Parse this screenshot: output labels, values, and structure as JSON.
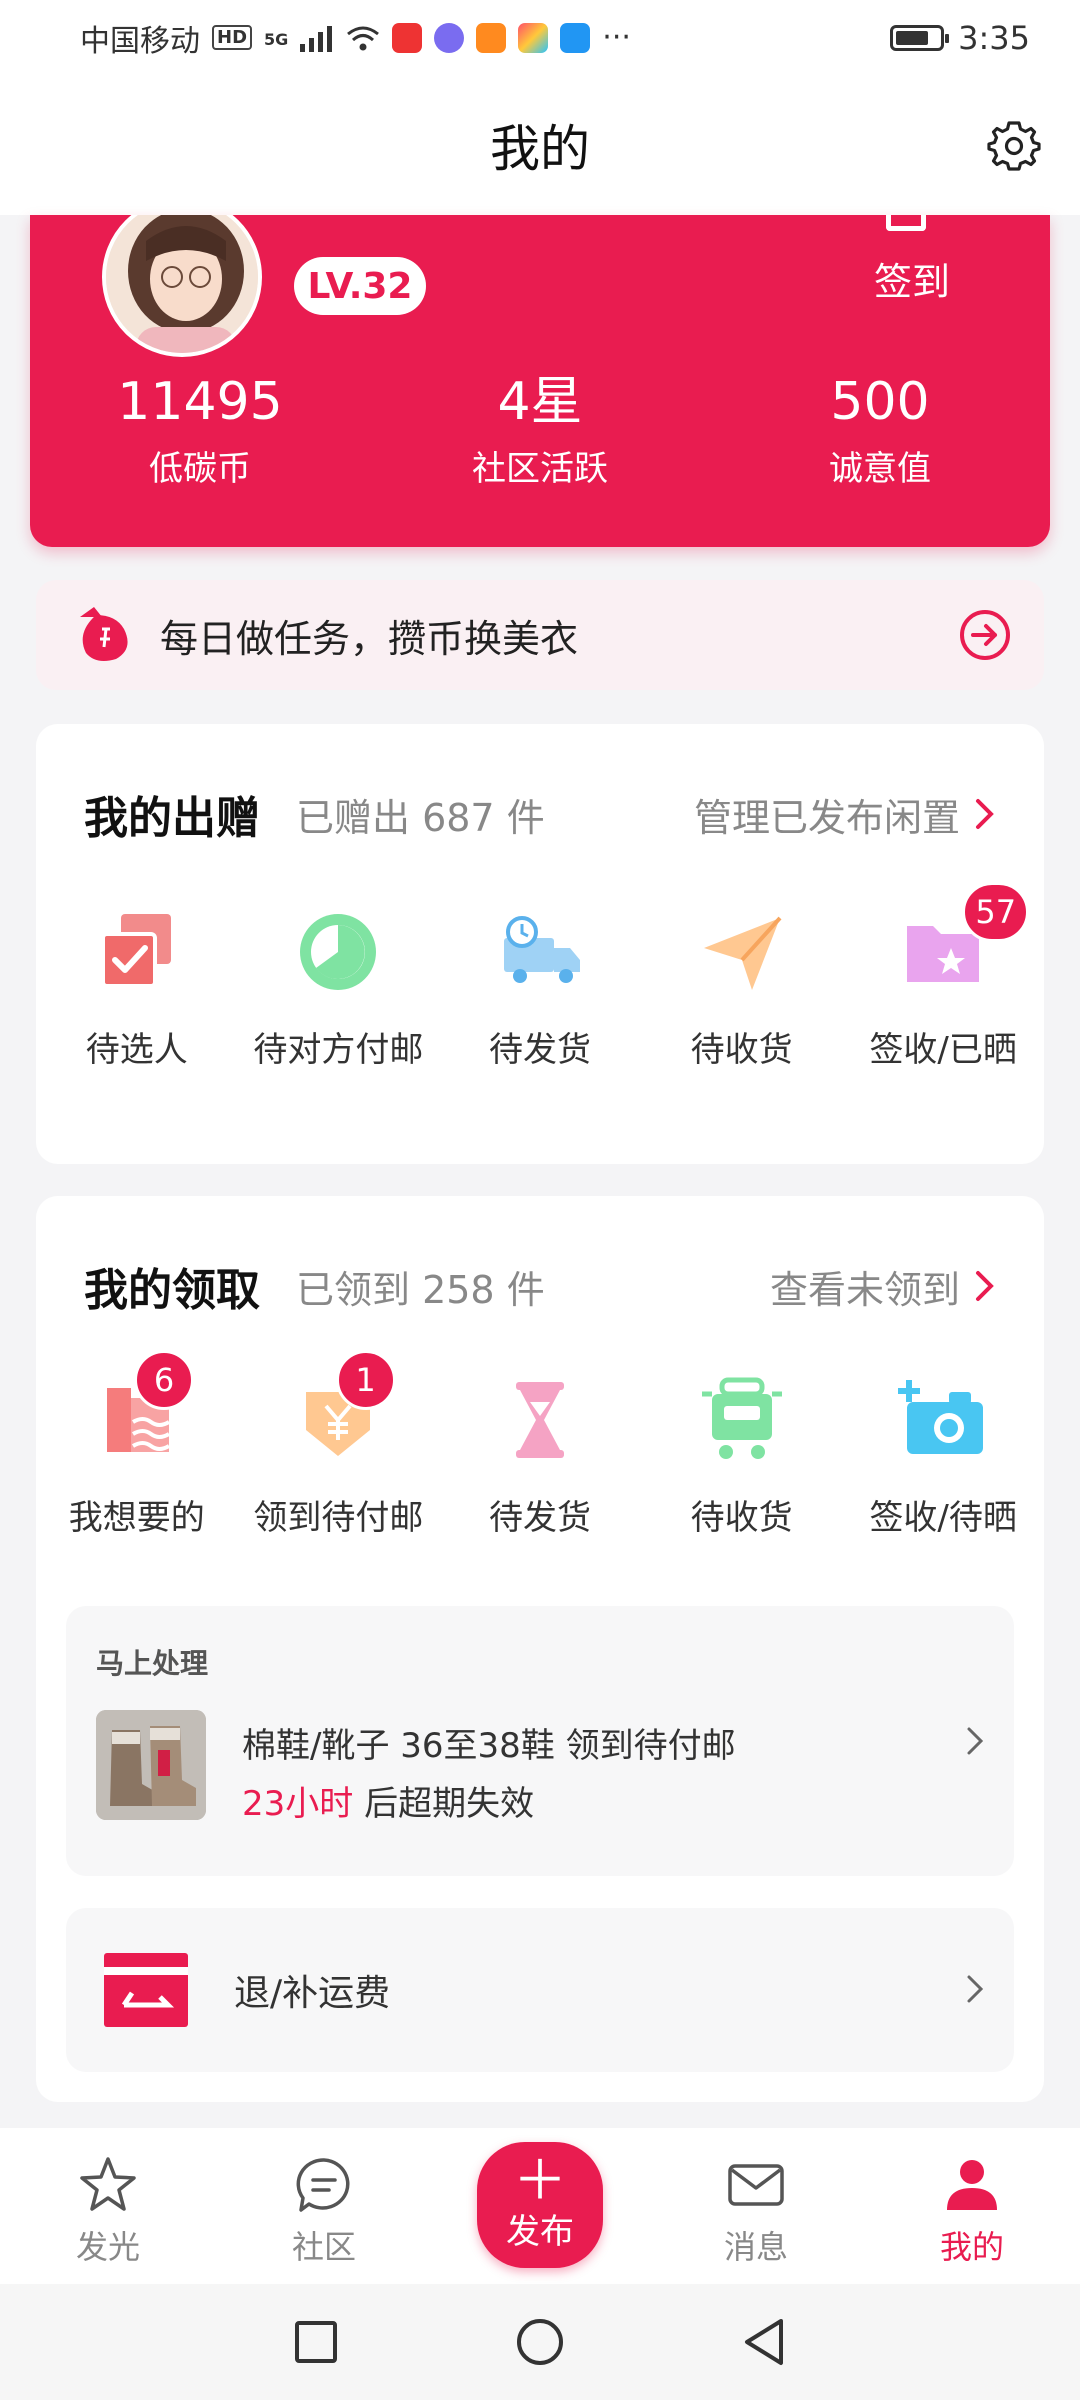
{
  "status_bar": {
    "carrier": "中国移动",
    "hd": "HD",
    "network": "5G",
    "more": "···",
    "time": "3:35"
  },
  "header": {
    "title": "我的"
  },
  "profile": {
    "level": "LV.32",
    "checkin_label": "签到",
    "stats": [
      {
        "value": "11495",
        "label": "低碳币"
      },
      {
        "value": "4星",
        "label": "社区活跃"
      },
      {
        "value": "500",
        "label": "诚意值"
      }
    ]
  },
  "task_banner": {
    "text": "每日做任务，攒币换美衣"
  },
  "give_section": {
    "title": "我的出赠",
    "count": "已赠出 687 件",
    "link": "管理已发布闲置",
    "items": [
      {
        "label": "待选人",
        "icon": "checked-copy-icon"
      },
      {
        "label": "待对方付邮",
        "icon": "clock-circle-icon"
      },
      {
        "label": "待发货",
        "icon": "delivery-truck-icon"
      },
      {
        "label": "待收货",
        "icon": "paper-plane-icon"
      },
      {
        "label": "签收/已晒",
        "icon": "folder-star-icon",
        "badge": "57"
      }
    ]
  },
  "receive_section": {
    "title": "我的领取",
    "count": "已领到 258 件",
    "link": "查看未领到",
    "items": [
      {
        "label": "我想要的",
        "icon": "shirt-icon",
        "badge": "6"
      },
      {
        "label": "领到待付邮",
        "icon": "yuan-pouch-icon",
        "badge": "1"
      },
      {
        "label": "待发货",
        "icon": "hourglass-icon"
      },
      {
        "label": "待收货",
        "icon": "cart-icon"
      },
      {
        "label": "签收/待晒",
        "icon": "camera-plus-icon"
      }
    ],
    "pending": {
      "heading": "马上处理",
      "item_title": "棉鞋/靴子 36至38鞋 领到待付邮",
      "deadline": "23小时",
      "deadline_suffix": " 后超期失效"
    },
    "refund": {
      "label": "退/补运费"
    }
  },
  "bottom_nav": {
    "items": [
      {
        "label": "发光",
        "icon": "star-icon"
      },
      {
        "label": "社区",
        "icon": "chat-bubble-icon"
      },
      {
        "label": "发布",
        "icon": "plus-icon"
      },
      {
        "label": "消息",
        "icon": "mail-icon"
      },
      {
        "label": "我的",
        "icon": "person-icon"
      }
    ]
  },
  "colors": {
    "accent": "#e91c50",
    "background": "#f4f4f6"
  }
}
